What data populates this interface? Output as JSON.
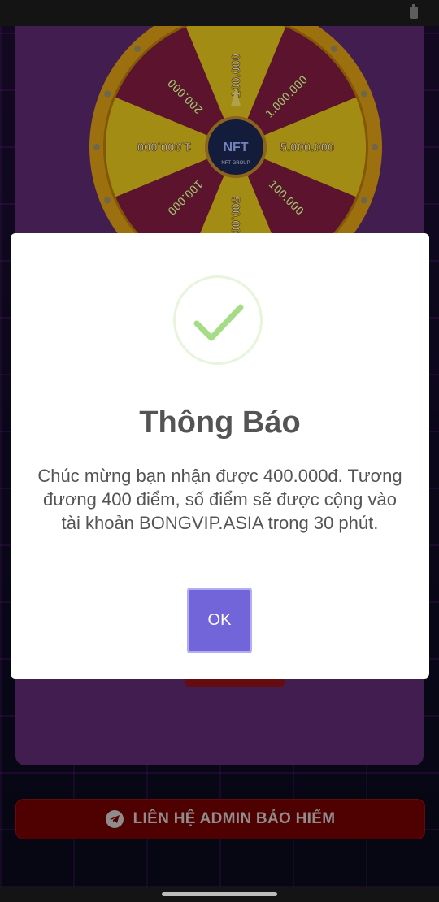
{
  "status_bar": {
    "battery_icon": "battery-icon"
  },
  "wheel": {
    "segments": [
      "100.000",
      "1.000.000",
      "5.000.000",
      "100.000",
      "500.000",
      "100.000",
      "1.000.000",
      "200.000"
    ],
    "center_logo_text": "NFT",
    "center_logo_subtext": "NFT GROUP",
    "colors": {
      "rim": "#d89b16",
      "segment_dark": "#7e1b40",
      "segment_light": "#e2c31c"
    }
  },
  "dialog": {
    "icon": "success-check-icon",
    "title": "Thông Báo",
    "message": "Chúc mừng bạn nhận được 400.000đ. Tương đương 400 điểm, số điểm sẽ được cộng vào tài khoản BONGVIP.ASIA trong 30 phút.",
    "ok_label": "OK",
    "colors": {
      "ok_button": "#7165d9",
      "check": "#a5dc86"
    }
  },
  "contact_button": {
    "icon": "telegram-icon",
    "label": "LIÊN HỆ ADMIN BẢO HIỂM"
  }
}
